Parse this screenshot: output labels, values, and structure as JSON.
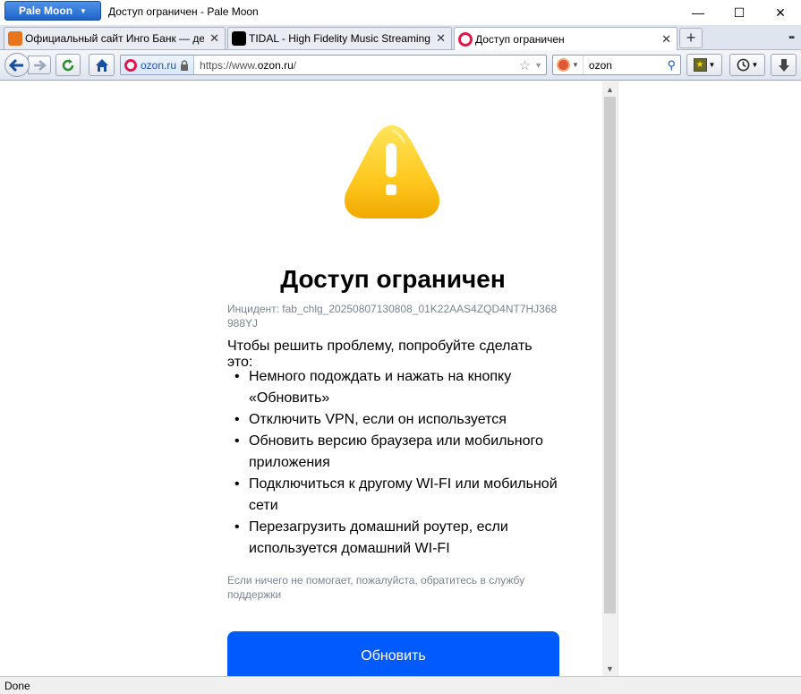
{
  "window": {
    "app_menu_label": "Pale Moon",
    "title": "Доступ ограничен - Pale Moon",
    "controls": {
      "minimize": "—",
      "maximize": "☐",
      "close": "✕"
    }
  },
  "tabs": [
    {
      "label": "Официальный сайт Инго Банк — дебе",
      "active": false
    },
    {
      "label": "TIDAL - High Fidelity Music Streaming",
      "active": false
    },
    {
      "label": "Доступ ограничен",
      "active": true
    }
  ],
  "newtab_label": "+",
  "tablist_label": "▪▪",
  "navbar": {
    "identity_label": "ozon.ru",
    "url_prefix": "https://www.",
    "url_domain": "ozon.ru",
    "url_suffix": "/",
    "search_value": "ozon"
  },
  "page": {
    "heading": "Доступ ограничен",
    "incident": "Инцидент: fab_chlg_20250807130808_01K22AAS4ZQD4NT7HJ368988YJ",
    "intro": "Чтобы решить проблему, попробуйте сделать это:",
    "steps": [
      "Немного подождать и нажать на кнопку «Обновить»",
      "Отключить VPN, если он используется",
      "Обновить версию браузера или мобильного приложения",
      "Подключиться к другому WI-FI или мобильной сети",
      "Перезагрузить домашний роутер, если используется домашний WI-FI"
    ],
    "help": "Если ничего не помогает, пожалуйста, обратитесь в службу поддержки",
    "refresh_label": "Обновить"
  },
  "status": "Done",
  "colors": {
    "accent": "#005bff",
    "warning": "#ffc81e"
  }
}
